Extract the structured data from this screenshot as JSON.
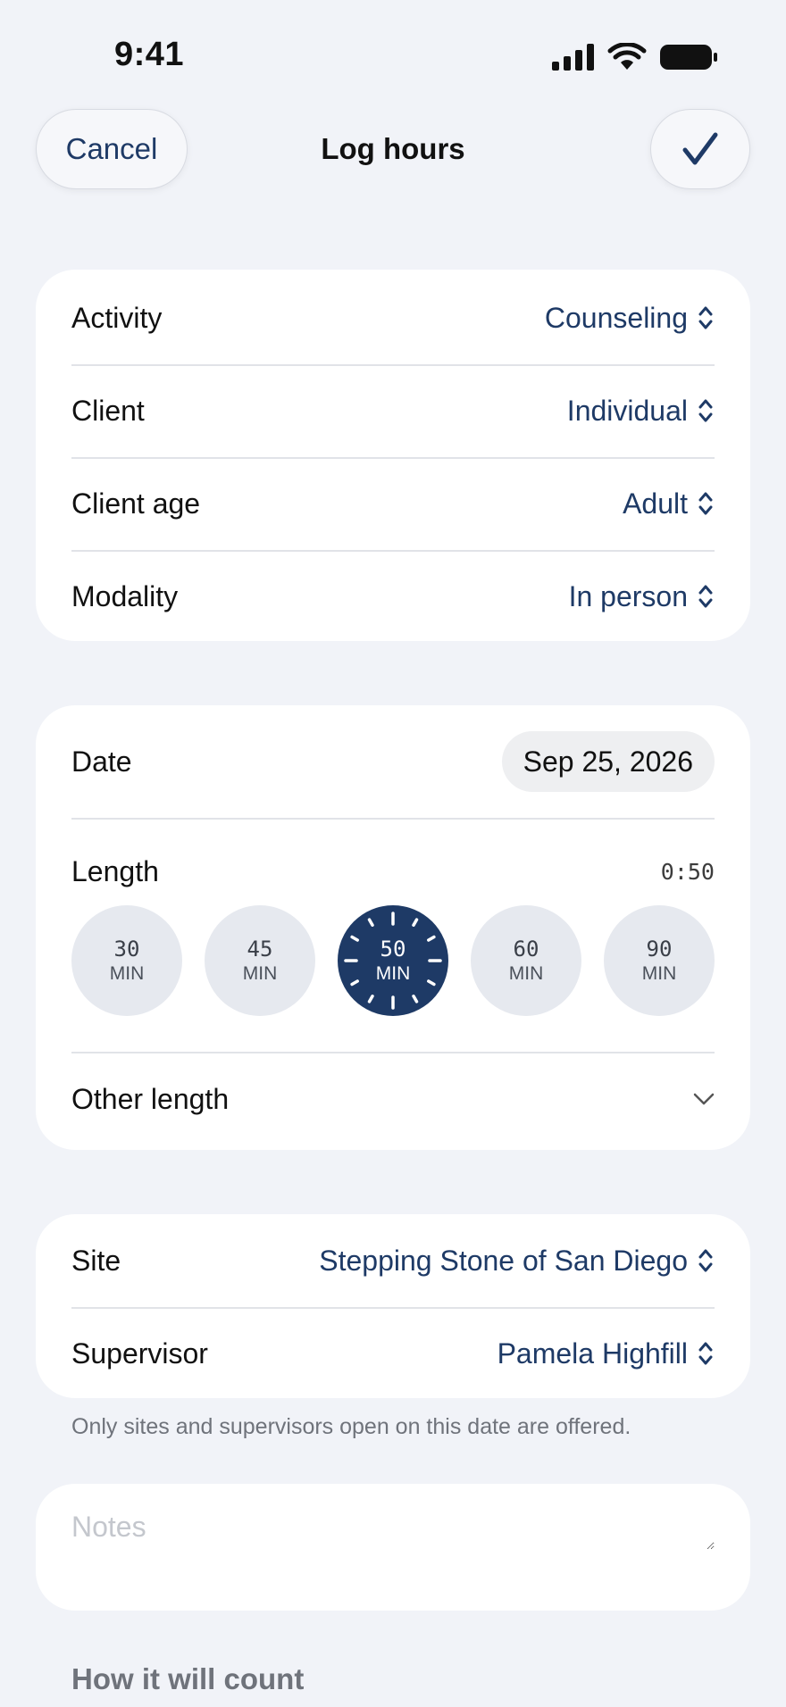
{
  "status_bar": {
    "time": "9:41"
  },
  "nav": {
    "cancel_label": "Cancel",
    "title": "Log hours"
  },
  "details": [
    {
      "label": "Activity",
      "value": "Counseling"
    },
    {
      "label": "Client",
      "value": "Individual"
    },
    {
      "label": "Client age",
      "value": "Adult"
    },
    {
      "label": "Modality",
      "value": "In person"
    }
  ],
  "session": {
    "date_label": "Date",
    "date_value": "Sep 25, 2026",
    "length_label": "Length",
    "length_total": "0:50",
    "length_options": [
      {
        "value": "30",
        "unit": "MIN"
      },
      {
        "value": "45",
        "unit": "MIN"
      },
      {
        "value": "50",
        "unit": "MIN"
      },
      {
        "value": "60",
        "unit": "MIN"
      },
      {
        "value": "90",
        "unit": "MIN"
      }
    ],
    "selected_length": "50",
    "other_length_label": "Other length"
  },
  "placement": {
    "site_label": "Site",
    "site_value": "Stepping Stone of San Diego",
    "supervisor_label": "Supervisor",
    "supervisor_value": "Pamela Highfill",
    "footnote": "Only sites and supervisors open on this date are offered."
  },
  "notes": {
    "placeholder": "Notes"
  },
  "count_section": {
    "title": "How it will count"
  },
  "colors": {
    "accent": "#1e3a66",
    "background": "#f1f3f8",
    "chip": "#e6e9ef"
  }
}
